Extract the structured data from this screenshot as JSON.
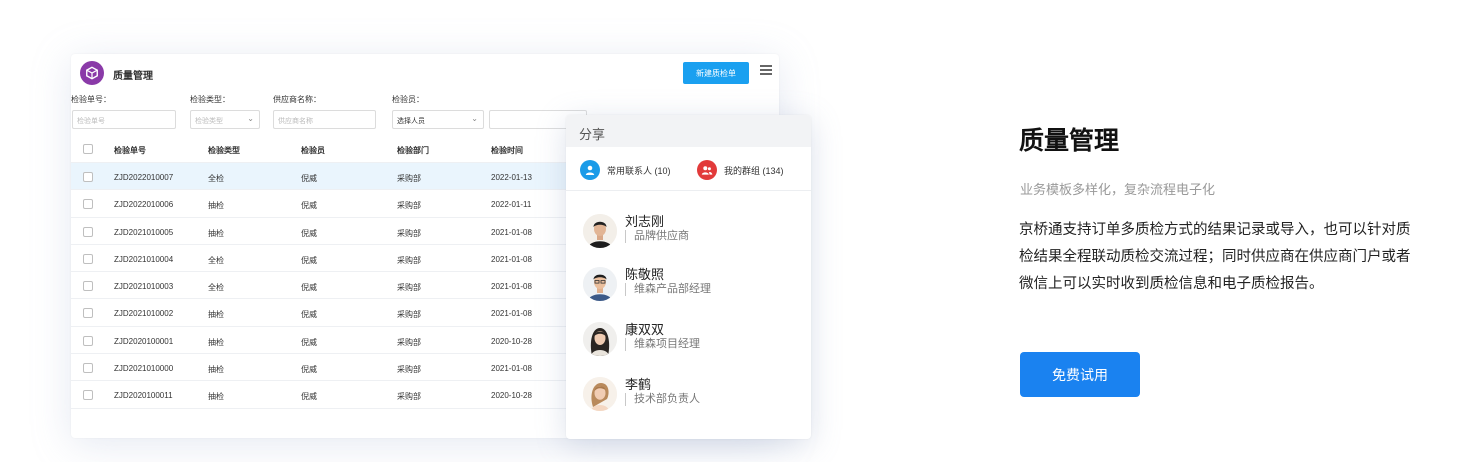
{
  "app": {
    "title": "质量管理",
    "new_button": "新建质检单",
    "menu_icon": "list-menu-icon",
    "logo_icon": "cube-icon"
  },
  "filters": {
    "labels": [
      "检验单号：",
      "检验类型：",
      "供应商名称：",
      "检验员："
    ],
    "order_no_placeholder": "检验单号",
    "type_placeholder": "检验类型",
    "supplier_placeholder": "供应商名称",
    "inspector_value": "选择人员"
  },
  "table": {
    "headers": [
      "检验单号",
      "检验类型",
      "检验员",
      "检验部门",
      "检验时间"
    ],
    "rows": [
      {
        "no": "ZJD2022010007",
        "type": "全检",
        "inspector": "倪威",
        "dept": "采购部",
        "date": "2022-01-13"
      },
      {
        "no": "ZJD2022010006",
        "type": "抽检",
        "inspector": "倪威",
        "dept": "采购部",
        "date": "2022-01-11"
      },
      {
        "no": "ZJD2021010005",
        "type": "抽检",
        "inspector": "倪威",
        "dept": "采购部",
        "date": "2021-01-08"
      },
      {
        "no": "ZJD2021010004",
        "type": "全检",
        "inspector": "倪威",
        "dept": "采购部",
        "date": "2021-01-08"
      },
      {
        "no": "ZJD2021010003",
        "type": "全检",
        "inspector": "倪威",
        "dept": "采购部",
        "date": "2021-01-08"
      },
      {
        "no": "ZJD2021010002",
        "type": "抽检",
        "inspector": "倪威",
        "dept": "采购部",
        "date": "2021-01-08"
      },
      {
        "no": "ZJD2020100001",
        "type": "抽检",
        "inspector": "倪威",
        "dept": "采购部",
        "date": "2020-10-28"
      },
      {
        "no": "ZJD2021010000",
        "type": "抽检",
        "inspector": "倪威",
        "dept": "采购部",
        "date": "2021-01-08"
      },
      {
        "no": "ZJD2020100011",
        "type": "抽检",
        "inspector": "倪威",
        "dept": "采购部",
        "date": "2020-10-28"
      }
    ]
  },
  "share": {
    "title": "分享",
    "tabs": [
      {
        "label": "常用联系人 (10)",
        "icon": "person-icon",
        "color": "#1a9be8"
      },
      {
        "label": "我的群组 (134)",
        "icon": "group-icon",
        "color": "#e23a3a"
      }
    ],
    "contacts": [
      {
        "name": "刘志刚",
        "role": "品牌供应商"
      },
      {
        "name": "陈敬照",
        "role": "维森产品部经理"
      },
      {
        "name": "康双双",
        "role": "维森项目经理"
      },
      {
        "name": "李鹤",
        "role": "技术部负责人"
      }
    ]
  },
  "promo": {
    "title": "质量管理",
    "subtitle": "业务模板多样化，复杂流程电子化",
    "description": "京桥通支持订单多质检方式的结果记录或导入，也可以针对质检结果全程联动质检交流过程；同时供应商在供应商门户或者微信上可以实时收到质检信息和电子质检报告。",
    "cta": "免费试用"
  },
  "colors": {
    "brand_blue": "#1a82f0",
    "new_button_blue": "#1aa0f0",
    "logo_purple": "#8a3aa8",
    "active_row": "#eaf5fd"
  }
}
